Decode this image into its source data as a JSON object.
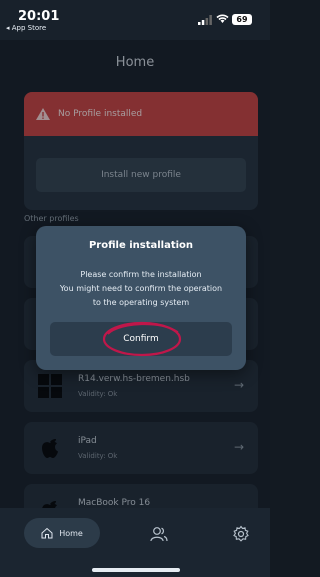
{
  "status_bar": {
    "time": "20:01",
    "back_app": "◂ App Store",
    "battery": "69"
  },
  "header": {
    "title": "Home"
  },
  "current_profile": {
    "alert_text": "No Profile installed",
    "install_button": "Install new profile"
  },
  "other_profiles": {
    "label": "Other profiles",
    "items": [
      {
        "name": "R14.verw.hs-bremen.hsb",
        "validity": "Validity: Ok",
        "icon": "windows-icon"
      },
      {
        "name": "iPad",
        "validity": "Validity: Ok",
        "icon": "apple-icon"
      },
      {
        "name": "MacBook Pro 16",
        "validity": "",
        "icon": "apple-icon"
      }
    ]
  },
  "modal": {
    "title": "Profile installation",
    "line1": "Please confirm the installation",
    "line2": "You might need to confirm the operation",
    "line3": "to the operating system",
    "confirm_button": "Confirm"
  },
  "bottom_nav": {
    "home_label": "Home"
  },
  "colors": {
    "alert": "#c74444",
    "annotation": "#c0174a",
    "modal": "#3d5265"
  }
}
